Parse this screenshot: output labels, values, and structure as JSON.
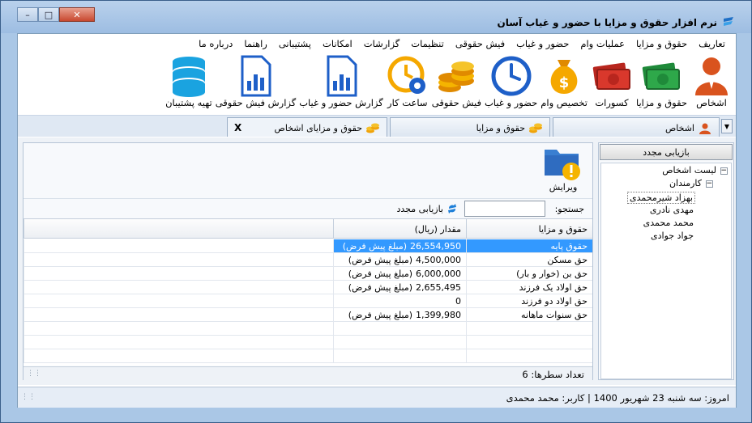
{
  "window": {
    "title": "نرم افزار حقوق و مزایا با حضور و غیاب آسان",
    "controls": {
      "minimize": "–",
      "maximize": "□",
      "close": "✕"
    }
  },
  "menu": [
    "تعاریف",
    "حقوق و مزایا",
    "عملیات وام",
    "حضور و غیاب",
    "فیش حقوقی",
    "تنظیمات",
    "گزارشات",
    "امکانات",
    "پشتیبانی",
    "راهنما",
    "درباره ما"
  ],
  "ribbon": [
    {
      "label": "اشخاص",
      "icon": "person-icon"
    },
    {
      "label": "حقوق و مزایا",
      "icon": "money-green-icon"
    },
    {
      "label": "کسورات",
      "icon": "money-red-icon"
    },
    {
      "label": "تخصیص وام",
      "icon": "money-bag-icon"
    },
    {
      "label": "حضور و غیاب",
      "icon": "clock-icon"
    },
    {
      "label": "فیش حقوقی",
      "icon": "coins-icon"
    },
    {
      "label": "ساعت کار",
      "icon": "clock-gear-icon"
    },
    {
      "label": "گزارش حضور و غیاب",
      "icon": "report-icon"
    },
    {
      "label": "گزارش فیش حقوقی",
      "icon": "report-icon"
    },
    {
      "label": "تهیه پشتیبان",
      "icon": "database-icon"
    }
  ],
  "tabs": [
    {
      "label": "اشخاص",
      "active": false
    },
    {
      "label": "حقوق و مزایا",
      "active": false
    },
    {
      "label": "حقوق و مزایای اشخاص",
      "active": true
    }
  ],
  "tab_close": "X",
  "right_panel": {
    "refresh": "بازیابی مجدد",
    "tree": {
      "root": "لیست اشخاص",
      "group": "کارمندان",
      "people": [
        "بهزاد شیرمحمدی",
        "مهدی نادری",
        "محمد محمدی",
        "جواد جوادی"
      ],
      "selected": 0
    }
  },
  "left_panel": {
    "edit_label": "ویرایش",
    "search_label": "جستجو:",
    "search_value": "",
    "refresh_label": "بازیابی مجدد",
    "columns": [
      "حقوق و مزایا",
      "مقدار (ریال)"
    ],
    "rows": [
      {
        "name": "حقوق پایه",
        "amount": "26,554,950",
        "note": "(مبلغ پیش فرض)"
      },
      {
        "name": "حق مسکن",
        "amount": "4,500,000",
        "note": "(مبلغ پیش فرض)"
      },
      {
        "name": "حق بن (خوار و بار)",
        "amount": "6,000,000",
        "note": "(مبلغ پیش فرض)"
      },
      {
        "name": "حق اولاد یک فرزند",
        "amount": "2,655,495",
        "note": "(مبلغ پیش فرض)"
      },
      {
        "name": "حق اولاد دو فرزند",
        "amount": "0",
        "note": ""
      },
      {
        "name": "حق سنوات ماهانه",
        "amount": "1,399,980",
        "note": "(مبلغ پیش فرض)"
      }
    ],
    "selected_row": 0,
    "row_count_text": "تعداد سطرها:  6"
  },
  "status": "امروز: سه شنبه 23 شهریور 1400   |   کاربر: محمد محمدی",
  "colors": {
    "selection": "#3399ff",
    "title_bg": "#aac7e6"
  }
}
